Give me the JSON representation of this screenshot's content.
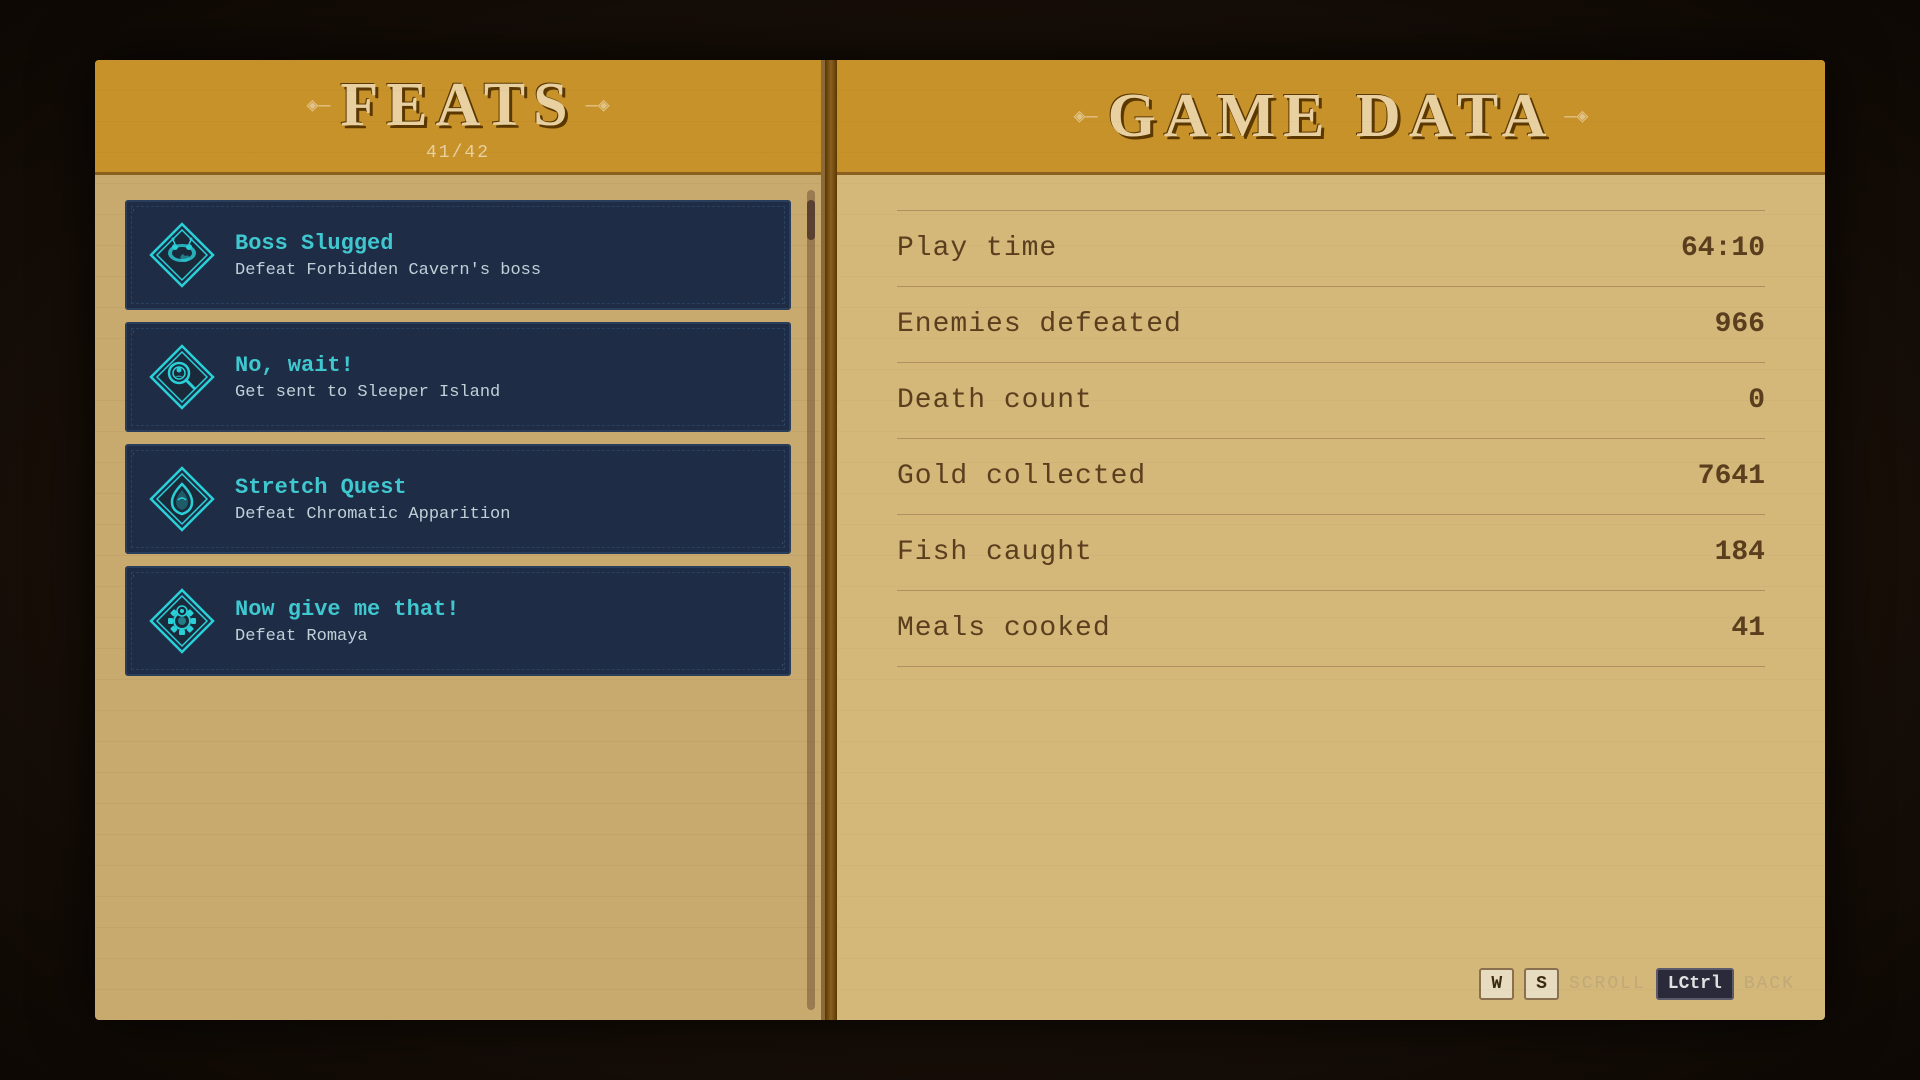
{
  "left": {
    "title_deco_left": "◈—",
    "title": "FEATS",
    "title_deco_right": "—◈",
    "subtitle": "41/42",
    "feats": [
      {
        "id": "boss-slugged",
        "title": "Boss Slugged",
        "description": "Defeat Forbidden Cavern's boss",
        "icon_type": "slug"
      },
      {
        "id": "no-wait",
        "title": "No, wait!",
        "description": "Get sent to Sleeper Island",
        "icon_type": "magnify"
      },
      {
        "id": "stretch-quest",
        "title": "Stretch Quest",
        "description": "Defeat Chromatic Apparition",
        "icon_type": "droplet"
      },
      {
        "id": "now-give",
        "title": "Now give me that!",
        "description": "Defeat Romaya",
        "icon_type": "gear"
      }
    ]
  },
  "right": {
    "title_deco_left": "◈—",
    "title": "GAME DATA",
    "title_deco_right": "—◈",
    "stats": [
      {
        "label": "Play time",
        "value": "64:10"
      },
      {
        "label": "Enemies defeated",
        "value": "966"
      },
      {
        "label": "Death count",
        "value": "0"
      },
      {
        "label": "Gold collected",
        "value": "7641"
      },
      {
        "label": "Fish caught",
        "value": "184"
      },
      {
        "label": "Meals cooked",
        "value": "41"
      }
    ]
  },
  "controls": [
    {
      "key": "W",
      "type": "light"
    },
    {
      "key": "S",
      "type": "light"
    },
    {
      "label": "SCROLL"
    },
    {
      "key": "LCtrl",
      "type": "dark"
    },
    {
      "label": "BACK"
    }
  ]
}
